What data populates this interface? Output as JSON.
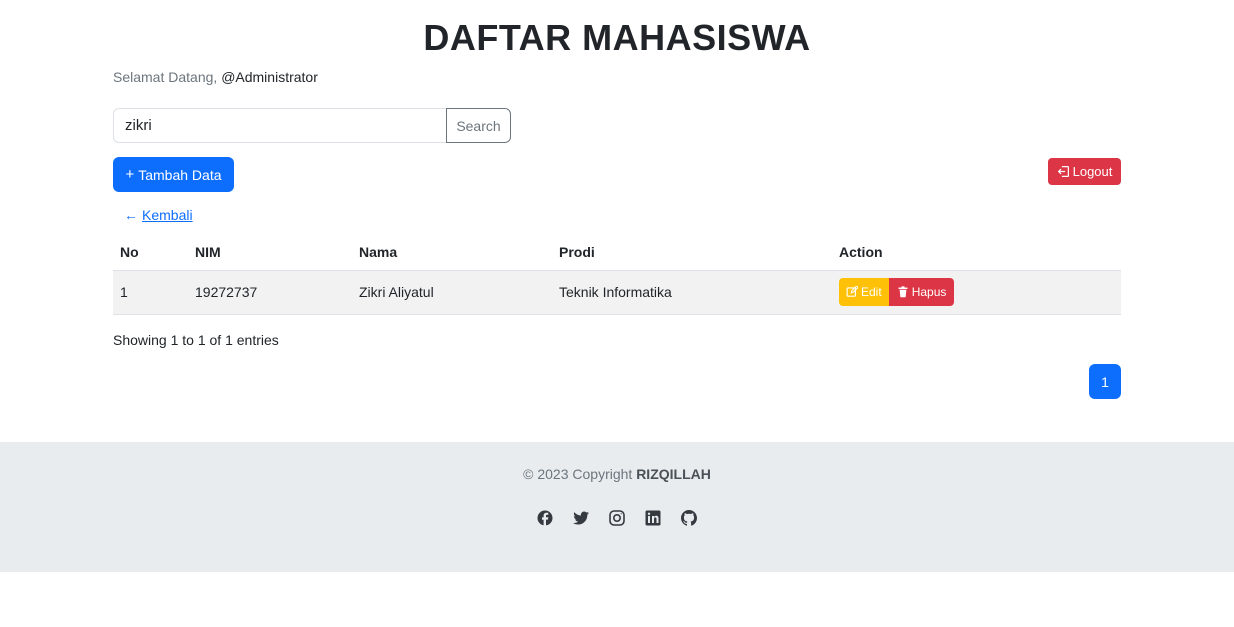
{
  "header": {
    "title": "DAFTAR MAHASISWA",
    "welcome_prefix": "Selamat Datang,",
    "welcome_user": "@Administrator"
  },
  "search": {
    "value": "zikri",
    "button_label": "Search"
  },
  "toolbar": {
    "add_label": "Tambah Data",
    "add_icon": "plus-icon",
    "logout_label": "Logout",
    "logout_icon": "logout-icon"
  },
  "back_link": {
    "label": "Kembali",
    "icon": "arrow-left-icon"
  },
  "table": {
    "columns": [
      "No",
      "NIM",
      "Nama",
      "Prodi",
      "Action"
    ],
    "rows": [
      {
        "no": "1",
        "nim": "19272737",
        "nama": "Zikri Aliyatul",
        "prodi": "Teknik Informatika",
        "edit_label": "Edit",
        "delete_label": "Hapus"
      }
    ]
  },
  "pagination": {
    "info": "Showing 1 to 1 of 1 entries",
    "pages": [
      "1"
    ],
    "active_page": "1"
  },
  "footer": {
    "copyright_prefix": "© 2023 Copyright",
    "copyright_owner": "RIZQILLAH",
    "social_icons": [
      "facebook-icon",
      "twitter-icon",
      "instagram-icon",
      "linkedin-icon",
      "github-icon"
    ]
  },
  "colors": {
    "primary": "#0d6efd",
    "danger": "#dc3545",
    "warning": "#ffc107",
    "footer_bg": "#e9ecef"
  }
}
